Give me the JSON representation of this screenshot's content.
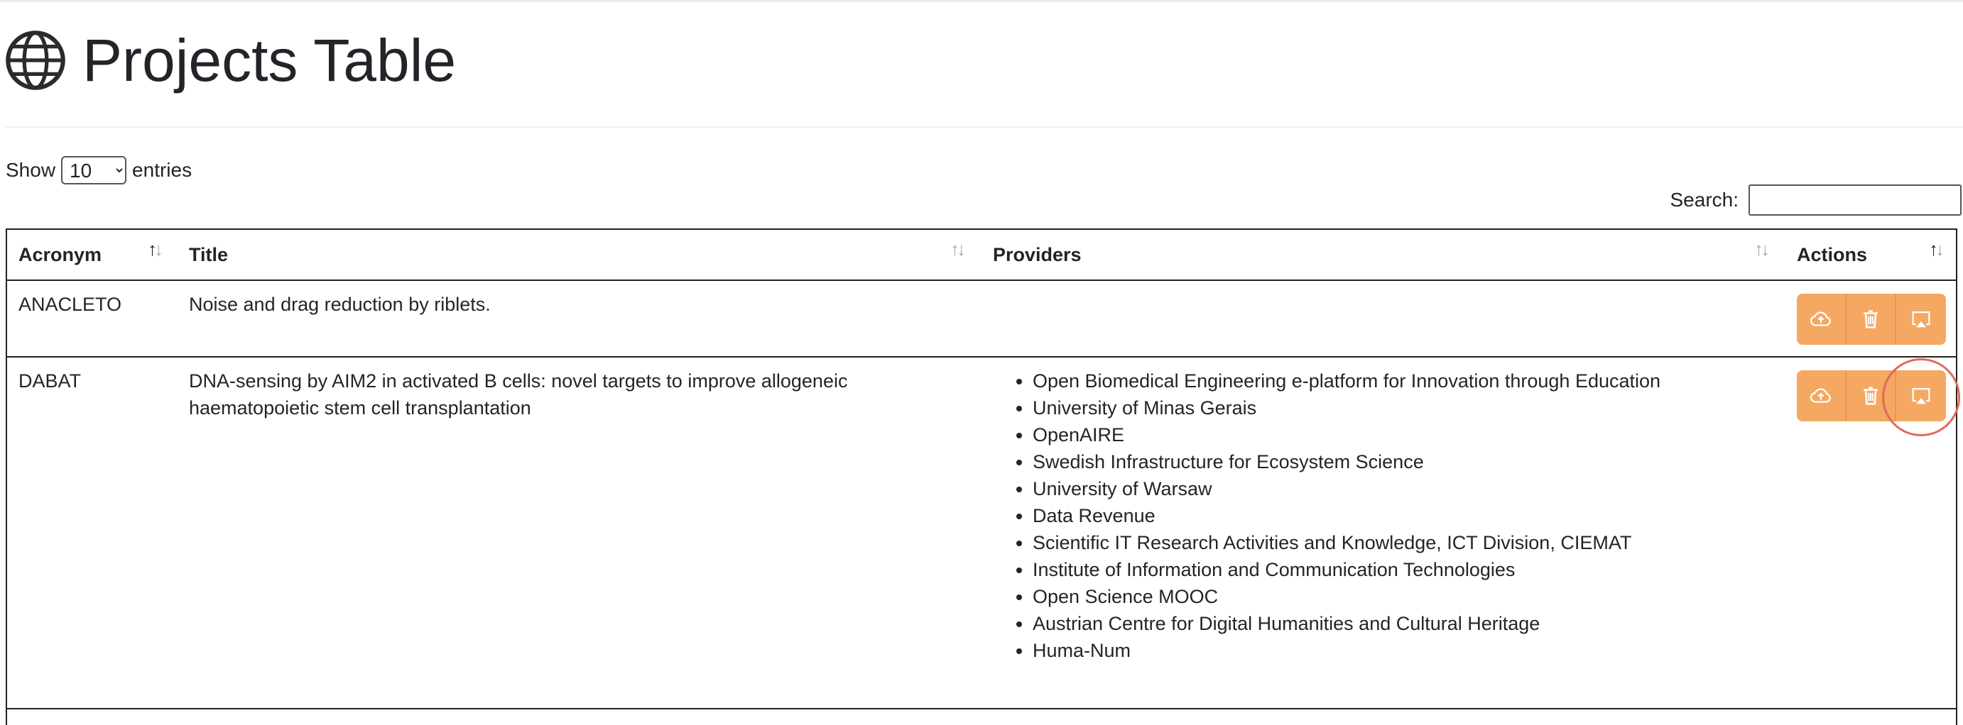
{
  "page": {
    "title": "Projects Table",
    "title_icon": "globe-icon"
  },
  "length_control": {
    "prefix": "Show",
    "selected": "10",
    "suffix": "entries"
  },
  "search": {
    "label": "Search:",
    "value": "",
    "placeholder": ""
  },
  "table": {
    "columns": [
      {
        "label": "Acronym",
        "sort_icon": "sort-icon",
        "sorted": true
      },
      {
        "label": "Title",
        "sort_icon": "sort-icon",
        "sorted": false
      },
      {
        "label": "Providers",
        "sort_icon": "sort-icon",
        "sorted": false
      },
      {
        "label": "Actions",
        "sort_icon": "sort-icon",
        "sorted": true
      }
    ],
    "rows": [
      {
        "acronym": "ANACLETO",
        "title_lines": [
          "Noise and drag reduction by riblets."
        ],
        "providers": []
      },
      {
        "acronym": "DABAT",
        "title_lines": [
          "DNA-sensing by AIM2 in activated B cells: novel targets to improve allogeneic",
          "haematopoietic stem cell transplantation"
        ],
        "providers": [
          "Open Biomedical Engineering e-platform for Innovation through Education",
          "University of Minas Gerais",
          "OpenAIRE",
          "Swedish Infrastructure for Ecosystem Science",
          "University of Warsaw",
          "Data Revenue",
          "Scientific IT Research Activities and Knowledge, ICT Division, CIEMAT",
          "Institute of Information and Communication Technologies",
          "Open Science MOOC",
          "Austrian Centre for Digital Humanities and Cultural Heritage",
          "Huma-Num"
        ]
      }
    ],
    "action_icons": [
      "cloud-upload-icon",
      "trash-icon",
      "airplay-icon"
    ]
  },
  "colors": {
    "action_button": "#f4a862",
    "highlight": "#e06a5c"
  }
}
